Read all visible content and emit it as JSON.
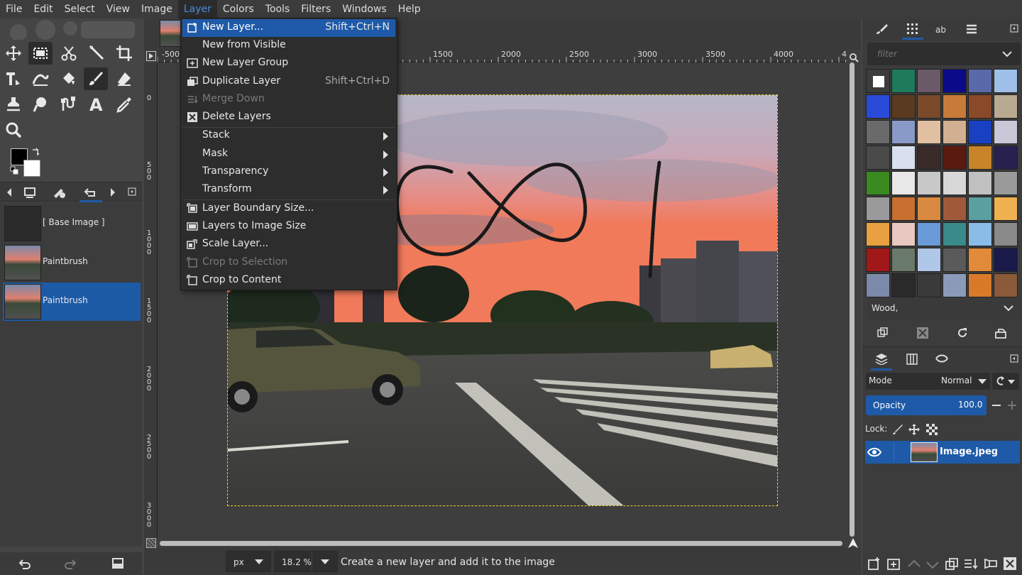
{
  "menubar": {
    "items": [
      "File",
      "Edit",
      "Select",
      "View",
      "Image",
      "Layer",
      "Colors",
      "Tools",
      "Filters",
      "Windows",
      "Help"
    ],
    "active": "Layer"
  },
  "layer_menu": {
    "items": [
      {
        "label": "New Layer...",
        "shortcut": "Shift+Ctrl+N",
        "icon": "new-layer-icon",
        "state": "highlighted"
      },
      {
        "label": "New from Visible",
        "shortcut": "",
        "icon": "",
        "state": "normal"
      },
      {
        "label": "New Layer Group",
        "shortcut": "",
        "icon": "new-layer-group-icon",
        "state": "normal"
      },
      {
        "label": "Duplicate Layer",
        "shortcut": "Shift+Ctrl+D",
        "icon": "duplicate-layer-icon",
        "state": "normal"
      },
      {
        "label": "Merge Down",
        "shortcut": "",
        "icon": "merge-down-icon",
        "state": "disabled"
      },
      {
        "label": "Delete Layers",
        "shortcut": "",
        "icon": "delete-layers-icon",
        "state": "normal"
      },
      {
        "label": "Stack",
        "submenu": true
      },
      {
        "label": "Mask",
        "submenu": true
      },
      {
        "label": "Transparency",
        "submenu": true
      },
      {
        "label": "Transform",
        "submenu": true
      },
      {
        "label": "Layer Boundary Size...",
        "icon": "layer-boundary-size-icon",
        "state": "normal"
      },
      {
        "label": "Layers to Image Size",
        "icon": "layers-to-image-size-icon",
        "state": "normal"
      },
      {
        "label": "Scale Layer...",
        "icon": "scale-layer-icon",
        "state": "normal"
      },
      {
        "label": "Crop to Selection",
        "icon": "crop-to-selection-icon",
        "state": "disabled"
      },
      {
        "label": "Crop to Content",
        "icon": "crop-to-content-icon",
        "state": "normal"
      }
    ]
  },
  "ruler": {
    "h_labels": [
      "-500",
      "1500",
      "2000",
      "2500",
      "3000",
      "3500",
      "4000",
      "4"
    ],
    "v_labels": [
      "0",
      "500",
      "1000",
      "1500",
      "2000",
      "2500",
      "3000"
    ]
  },
  "history": {
    "items": [
      {
        "label": "[ Base Image ]",
        "selected": false
      },
      {
        "label": "Paintbrush",
        "selected": false
      },
      {
        "label": "Paintbrush",
        "selected": true
      }
    ]
  },
  "statusbar": {
    "unit": "px",
    "zoom": "18.2 %",
    "message": "Create a new layer and add it to the image"
  },
  "patterns": {
    "filter_placeholder": "filter",
    "selected_name": "Wood,",
    "swatch_colors": [
      "#ffffff",
      "#1e7a5a",
      "#6a5a6a",
      "#0b0b8a",
      "#5a6aa8",
      "#9ec0e8",
      "#2a4ad8",
      "#5a3a20",
      "#7a4a2a",
      "#c87a3a",
      "#8a4a2a",
      "#b8aa90",
      "#6a6a6a",
      "#8a9ac8",
      "#e0c0a0",
      "#d0b090",
      "#1840c0",
      "#c8c8d8",
      "#4a4a4a",
      "#d8e0f0",
      "#3a2a2a",
      "#5a1a10",
      "#c8842a",
      "#2a2050",
      "#3a8a20",
      "#e8e8e8",
      "#c8c8c8",
      "#d8d8d8",
      "#c0c0c0",
      "#9a9a9a",
      "#9a9a9a",
      "#c87030",
      "#d88a40",
      "#a05a3a",
      "#5aa0a0",
      "#f0b050",
      "#e8a040",
      "#e8c8c0",
      "#6a9ad8",
      "#3a8a8a",
      "#8abce8",
      "#8a8a8a",
      "#a01818",
      "#6a7a6a",
      "#b0c8e8",
      "#5a5a5a",
      "#e08a3a",
      "#1a1a4a",
      "#7a8aa8",
      "#2a2a2a",
      "#3a3a3a",
      "#8a9ab8",
      "#d87a2a",
      "#8a5a3a"
    ]
  },
  "layers_panel": {
    "mode_label": "Mode",
    "mode_value": "Normal",
    "opacity_label": "Opacity",
    "opacity_value": "100.0",
    "lock_label": "Lock:",
    "layer_name": "Image.jpeg"
  },
  "colors": {
    "accent": "#1e5aa8",
    "menu_bg": "#2d2d2d",
    "panel_bg": "#3c3c3c",
    "selection_dash": "#e6d23a"
  }
}
